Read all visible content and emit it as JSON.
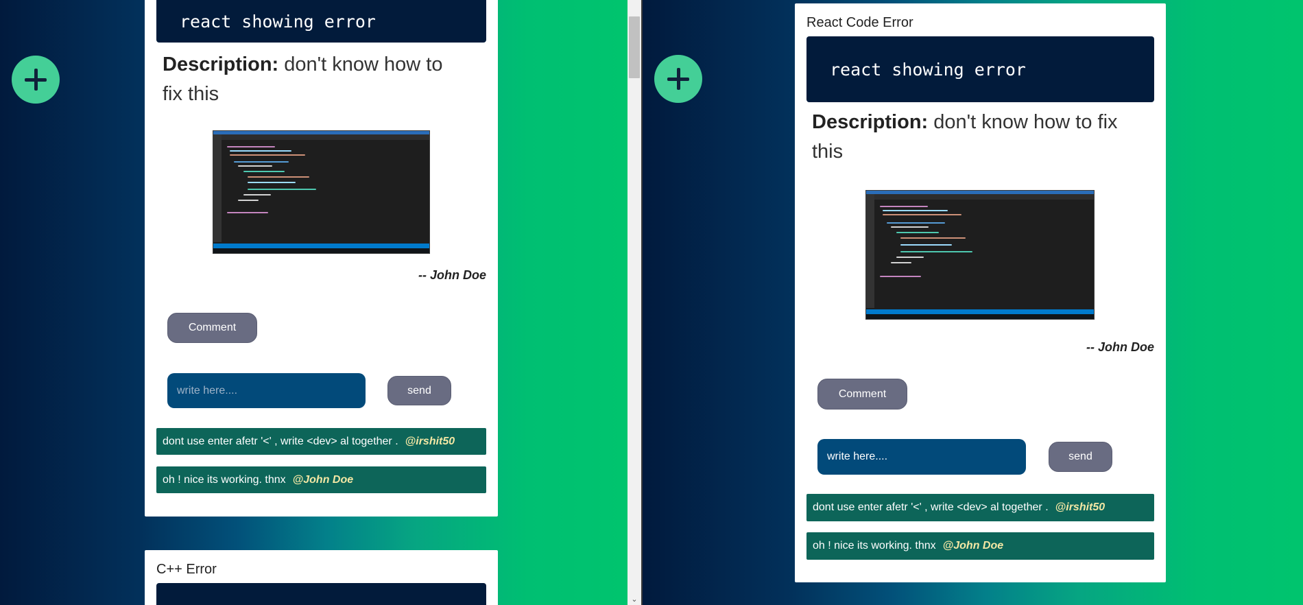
{
  "add_button": {
    "icon": "plus-icon",
    "color": "#44cf97"
  },
  "left_pane": {
    "post": {
      "code_snippet": "react showing error",
      "description_label": "Description:",
      "description_text": "don't know how to fix this",
      "author": "-- John Doe",
      "comment_button": "Comment",
      "input_placeholder": "write here....",
      "send_button": "send",
      "comments": [
        {
          "text": "dont use enter afetr '<' , write <dev> al together .",
          "handle": "@irshit50"
        },
        {
          "text": "oh ! nice its working. thnx",
          "handle": "@John Doe"
        }
      ]
    },
    "next_post": {
      "title": "C++ Error"
    }
  },
  "right_pane": {
    "post": {
      "title": "React Code Error",
      "code_snippet": "react showing error",
      "description_label": "Description:",
      "description_text": "don't know how to fix this",
      "author": "-- John Doe",
      "comment_button": "Comment",
      "input_placeholder": "write here....",
      "send_button": "send",
      "comments": [
        {
          "text": "dont use enter afetr '<' , write <dev> al together .",
          "handle": "@irshit50"
        },
        {
          "text": "oh ! nice its working. thnx",
          "handle": "@John Doe"
        }
      ]
    }
  },
  "colors": {
    "code_bg": "#021b3b",
    "comment_bg": "#0d6559",
    "handle": "#f3e7a4",
    "button_gray": "#696c82",
    "input_bg": "#024a7a"
  }
}
